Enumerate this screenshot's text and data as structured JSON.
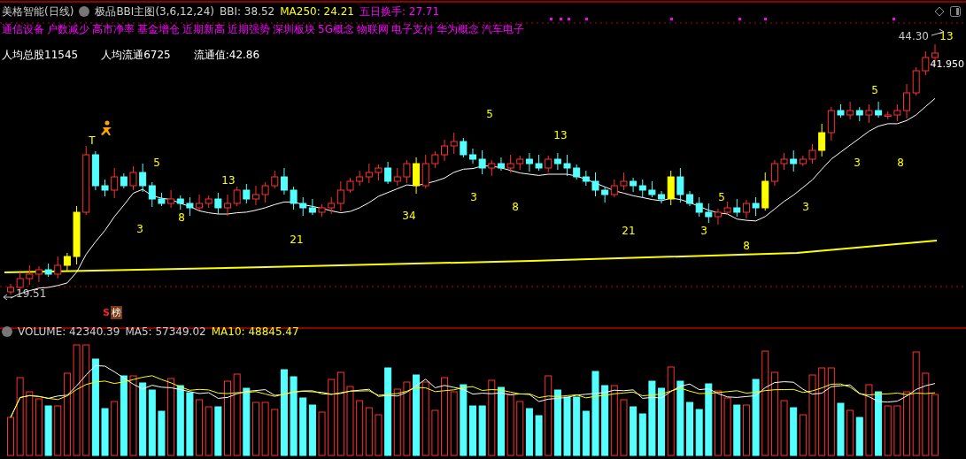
{
  "title": {
    "stock": "美格智能(日线)",
    "indicator": "极品BBI主图(3,6,12,24)",
    "bbi": "BBI: 38.52",
    "ma250": "MA250: 24.21",
    "turnover": "五日换手: 27.71"
  },
  "tags": [
    "通信设备",
    "户数减少",
    "高市净率",
    "基金增仓",
    "近期新高",
    "近期强势",
    "深圳板块",
    "5G概念",
    "物联网",
    "电子支付",
    "华为概念",
    "汽车电子"
  ],
  "stats": [
    "人均总股11545",
    "人均流通6725",
    "流通值:42.86"
  ],
  "price_chart": {
    "high_label": "44.30",
    "last_label": "41.950",
    "low_label": "19.51",
    "markers": [
      "T",
      "3",
      "5",
      "8",
      "13",
      "21",
      "34",
      "3",
      "5",
      "8",
      "13",
      "21",
      "3",
      "5",
      "8",
      "3",
      "3",
      "5",
      "8",
      "13"
    ],
    "signal_badge": {
      "letter": "S",
      "label": "榜"
    }
  },
  "volume": {
    "volume": "VOLUME: 42340.39",
    "ma5": "MA5: 57349.02",
    "ma10": "MA10: 48845.47"
  }
}
